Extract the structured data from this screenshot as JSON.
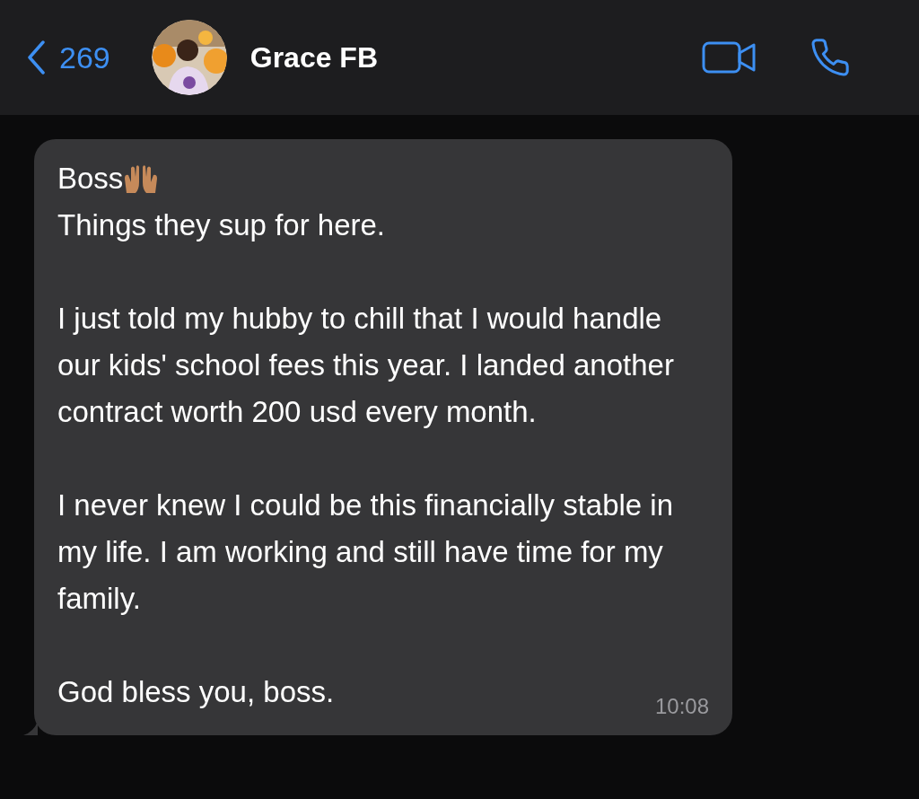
{
  "header": {
    "back_count": "269",
    "contact_name": "Grace FB"
  },
  "message": {
    "greeting": "Boss",
    "paragraphs": [
      [
        "Things they sup for here."
      ],
      [
        "I just told my hubby to chill that I would handle our kids' school fees this year. I landed another contract worth 200 usd every month."
      ],
      [
        "I never knew I could be this financially stable in my life. I am working and still have time for my family."
      ],
      [
        "God bless you, boss."
      ]
    ],
    "time": "10:08"
  }
}
